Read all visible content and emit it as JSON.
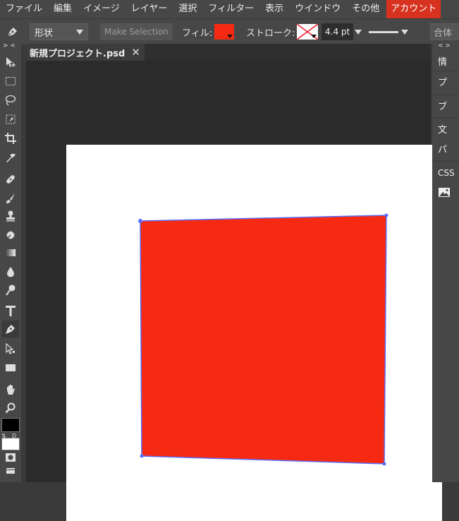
{
  "menu": {
    "items": [
      "ファイル",
      "編集",
      "イメージ",
      "レイヤー",
      "選択",
      "フィルター",
      "表示",
      "ウインドウ",
      "その他"
    ],
    "account": "アカウント"
  },
  "options": {
    "tool_icon": "pen-icon",
    "shape_mode": "形状",
    "make_selection": "Make Selection",
    "fill_label": "フィル:",
    "fill_color": "#f62a13",
    "stroke_label": "ストローク:",
    "stroke_value": "4.4 pt",
    "combine_label": "合体"
  },
  "toolbar": {
    "collapse": "> <",
    "fg_color": "#000000",
    "bg_color": "#ffffff",
    "swap_label": "⇅",
    "default_label": "D",
    "tools": [
      "move-tool-icon",
      "marquee-tool-icon",
      "lasso-tool-icon",
      "quick-select-tool-icon",
      "crop-tool-icon",
      "eyedropper-tool-icon",
      "healing-tool-icon",
      "brush-tool-icon",
      "clone-stamp-tool-icon",
      "eraser-tool-icon",
      "gradient-tool-icon",
      "blur-tool-icon",
      "dodge-tool-icon",
      "type-tool-icon",
      "pen-tool-icon",
      "path-select-tool-icon",
      "rectangle-tool-icon",
      "hand-tool-icon",
      "zoom-tool-icon"
    ]
  },
  "document": {
    "tab_title": "新規プロジェクト.psd",
    "close": "✕"
  },
  "right_panel": {
    "collapse": "< >",
    "items": [
      "情",
      "プ",
      "ブ",
      "文",
      "パ",
      "CSS"
    ]
  },
  "shape": {
    "fill": "#f62a13",
    "stroke": "#5b6cf7"
  }
}
